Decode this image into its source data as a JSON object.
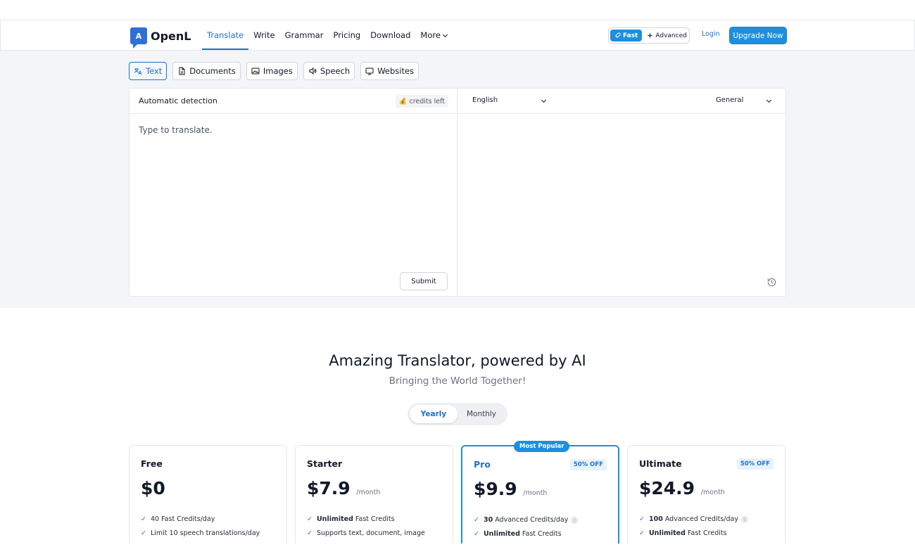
{
  "header": {
    "logo_text": "OpenL",
    "nav": [
      "Translate",
      "Write",
      "Grammar",
      "Pricing",
      "Download",
      "More"
    ],
    "mode_fast": "Fast",
    "mode_advanced": "Advanced",
    "login": "Login",
    "upgrade": "Upgrade Now"
  },
  "tool_tabs": [
    "Text",
    "Documents",
    "Images",
    "Speech",
    "Websites"
  ],
  "translator": {
    "source_lang": "Automatic detection",
    "credits": "credits left",
    "placeholder": "Type to translate.",
    "submit": "Submit",
    "target_lang": "English",
    "domain": "General"
  },
  "hero": {
    "title": "Amazing Translator, powered by AI",
    "subtitle": "Bringing the World Together!"
  },
  "billing": {
    "yearly": "Yearly",
    "monthly": "Monthly"
  },
  "plans": [
    {
      "name": "Free",
      "price": "$0",
      "per": "",
      "off": "",
      "f1_bold": "",
      "f1": "40 Fast Credits/day",
      "f2_bold": "",
      "f2": "Limit 10 speech translations/day"
    },
    {
      "name": "Starter",
      "price": "$7.9",
      "per": "/month",
      "off": "",
      "f1_bold": "Unlimited",
      "f1": " Fast Credits",
      "f2_bold": "",
      "f2": "Supports text, document, image"
    },
    {
      "name": "Pro",
      "price": "$9.9",
      "per": "/month",
      "off": "50% OFF",
      "badge": "Most Popular",
      "f1_bold": "30",
      "f1": " Advanced Credits/day",
      "f2_bold": "Unlimited",
      "f2": " Fast Credits"
    },
    {
      "name": "Ultimate",
      "price": "$24.9",
      "per": "/month",
      "off": "50% OFF",
      "f1_bold": "100",
      "f1": " Advanced Credits/day",
      "f2_bold": "Unlimited",
      "f2": " Fast Credits"
    }
  ]
}
